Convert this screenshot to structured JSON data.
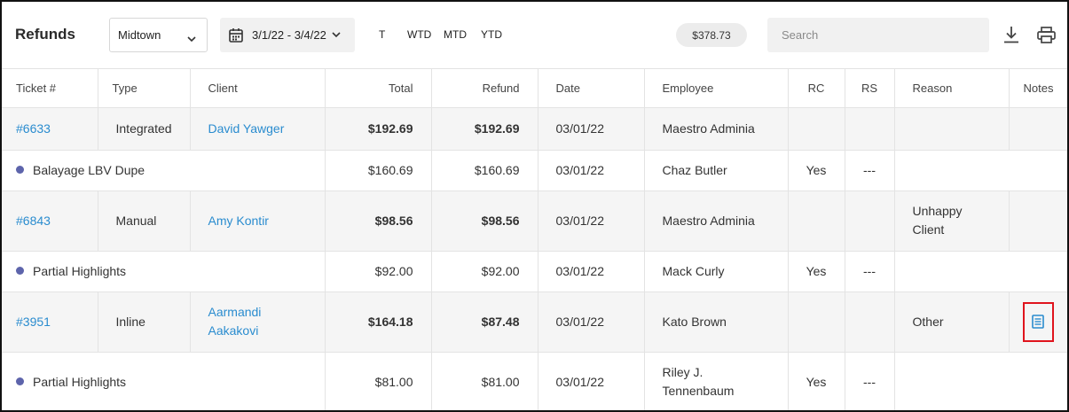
{
  "header": {
    "title": "Refunds",
    "location": "Midtown",
    "date_range": "3/1/22 - 3/4/22",
    "quick_ranges": [
      "T",
      "WTD",
      "MTD",
      "YTD"
    ],
    "total": "$378.73",
    "search_placeholder": "Search"
  },
  "columns": [
    "Ticket #",
    "Type",
    "Client",
    "Total",
    "Refund",
    "Date",
    "Employee",
    "RC",
    "RS",
    "Reason",
    "Notes"
  ],
  "rows": [
    {
      "ticket": "#6633",
      "type": "Integrated",
      "client": "David Yawger",
      "total": "$192.69",
      "refund": "$192.69",
      "date": "03/01/22",
      "employee": "Maestro Adminia",
      "reason": ""
    },
    {
      "item": "Balayage LBV Dupe",
      "total": "$160.69",
      "refund": "$160.69",
      "date": "03/01/22",
      "employee": "Chaz Butler",
      "rc": "Yes",
      "rs": "---"
    },
    {
      "ticket": "#6843",
      "type": "Manual",
      "client": "Amy Kontir",
      "total": "$98.56",
      "refund": "$98.56",
      "date": "03/01/22",
      "employee": "Maestro Adminia",
      "reason": "Unhappy Client"
    },
    {
      "item": "Partial Highlights",
      "total": "$92.00",
      "refund": "$92.00",
      "date": "03/01/22",
      "employee": "Mack Curly",
      "rc": "Yes",
      "rs": "---"
    },
    {
      "ticket": "#3951",
      "type": "Inline",
      "client": "Aarmandi Aakakovi",
      "total": "$164.18",
      "refund": "$87.48",
      "date": "03/01/22",
      "employee": "Kato Brown",
      "reason": "Other",
      "notes_icon": "notes-icon"
    },
    {
      "item": "Partial Highlights",
      "total": "$81.00",
      "refund": "$81.00",
      "date": "03/01/22",
      "employee": "Riley J. Tennenbaum",
      "rc": "Yes",
      "rs": "---"
    }
  ],
  "colors": {
    "link": "#2a8ccf",
    "dot": "#5d64ab",
    "highlight": "#e0141d",
    "row_shade": "#f5f5f5"
  }
}
